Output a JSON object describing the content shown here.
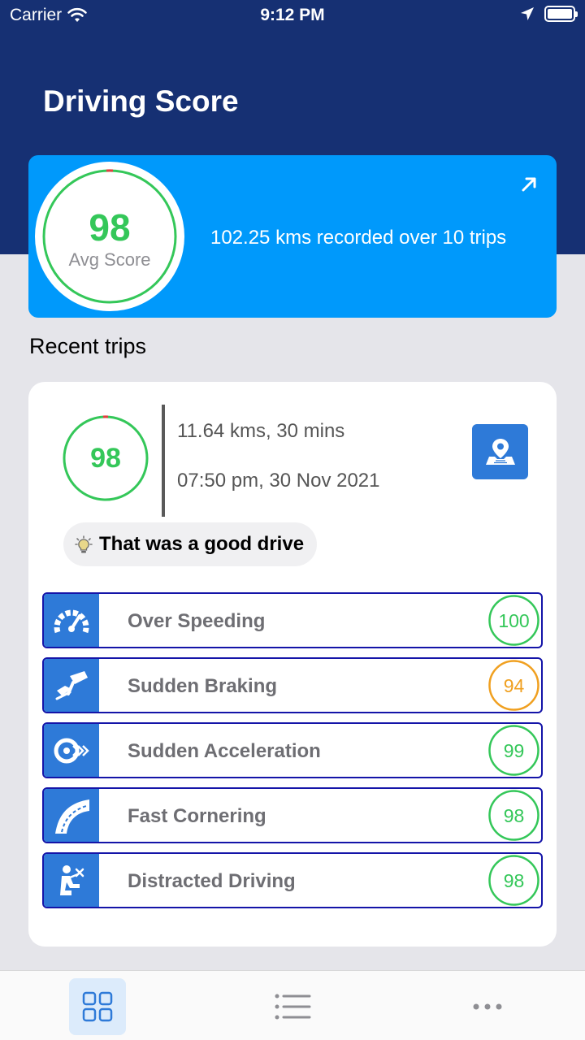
{
  "status_bar": {
    "carrier": "Carrier",
    "time": "9:12 PM"
  },
  "header": {
    "title": "Driving Score"
  },
  "summary": {
    "avg_score": "98",
    "avg_label": "Avg Score",
    "description": "102.25 kms recorded over 10 trips"
  },
  "recent_trips": {
    "title": "Recent trips",
    "trip": {
      "score": "98",
      "distance_duration": "11.64 kms, 30 mins",
      "datetime": "07:50 pm, 30 Nov 2021",
      "feedback": "That was a good drive",
      "metrics": [
        {
          "label": "Over Speeding",
          "score": "100",
          "status": "good",
          "icon": "speedometer-icon"
        },
        {
          "label": "Sudden Braking",
          "score": "94",
          "status": "warning",
          "icon": "brake-pedal-icon"
        },
        {
          "label": "Sudden Acceleration",
          "score": "99",
          "status": "good",
          "icon": "acceleration-icon"
        },
        {
          "label": "Fast Cornering",
          "score": "98",
          "status": "good",
          "icon": "curved-road-icon"
        },
        {
          "label": "Distracted Driving",
          "score": "98",
          "status": "good",
          "icon": "distracted-driver-icon"
        }
      ]
    }
  },
  "colors": {
    "header": "#163073",
    "summary_card": "#0099fb",
    "good": "#34c759",
    "warning": "#f0a020",
    "icon_bg": "#2e7ad8",
    "row_border": "#1414a8"
  },
  "tab_bar": {
    "tabs": [
      {
        "name": "dashboard-icon",
        "active": true
      },
      {
        "name": "list-icon",
        "active": false
      },
      {
        "name": "more-icon",
        "active": false
      }
    ]
  }
}
